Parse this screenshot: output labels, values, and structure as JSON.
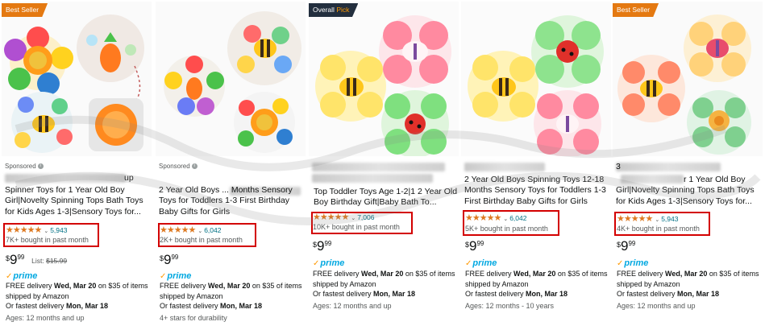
{
  "colors": {
    "badge_best_seller": "#e47911",
    "badge_overall": "#232f3e",
    "star": "#de7921",
    "link": "#007185",
    "prime": "#00a8e1",
    "highlight_box": "#d30000"
  },
  "products": [
    {
      "badge": "Best Seller",
      "sponsored": "Sponsored",
      "title": "Spinner Toys for 1 Year Old Boy Girl|Novelty Spinning Tops Bath Toys for Kids Ages 1-3|Sensory Toys for...",
      "title_partial": "up",
      "rating": 4.5,
      "rating_count": "5,943",
      "bought": "7K+ bought in past month",
      "price_whole": "9",
      "price_fraction": "99",
      "list_label": "List:",
      "list_price": "$15.99",
      "prime": "prime",
      "delivery_line1": "FREE delivery",
      "delivery_date": "Wed, Mar 20",
      "delivery_tail": "on $35 of items shipped by Amazon",
      "fastest_label": "Or fastest delivery",
      "fastest_date": "Mon, Mar 18",
      "extra": "Ages: 12 months and up",
      "image_icons": [
        "sunflower-spinner-icon",
        "carrot-spinner-icon",
        "bee-spinner-icon",
        "orange-cup-icon"
      ]
    },
    {
      "badge": "",
      "sponsored": "Sponsored",
      "title": "2 Year Old Boys ... Months Sensory Toys for Toddlers 1-3 First Birthday Baby Gifts for Girls",
      "rating": 4.5,
      "rating_count": "6,042",
      "bought": "2K+ bought in past month",
      "price_whole": "9",
      "price_fraction": "99",
      "prime": "prime",
      "delivery_line1": "FREE delivery",
      "delivery_date": "Wed, Mar 20",
      "delivery_tail": "on $35 of items shipped by Amazon",
      "fastest_label": "Or fastest delivery",
      "fastest_date": "Mon, Mar 18",
      "extra": "4+ stars for durability",
      "image_icons": [
        "carrot-spinner-icon",
        "bee-spinner-icon",
        "sunflower-spinner-icon"
      ]
    },
    {
      "badge_prefix": "Overall",
      "badge": "Pick",
      "sponsored": "",
      "title": "Top Toddler Toys Age 1-2|1 2 Year Old Boy Birthday Gift|Baby Bath To...",
      "rating": 4.5,
      "rating_count": "7,006",
      "bought": "10K+ bought in past month",
      "price_whole": "9",
      "price_fraction": "99",
      "prime": "prime",
      "delivery_line1": "FREE delivery",
      "delivery_date": "Wed, Mar 20",
      "delivery_tail": "on $35 of items shipped by Amazon",
      "fastest_label": "Or fastest delivery",
      "fastest_date": "Mon, Mar 18",
      "extra": "Ages: 12 months and up",
      "image_icons": [
        "bee-spinner-icon",
        "butterfly-spinner-icon",
        "ladybug-spinner-icon"
      ]
    },
    {
      "badge": "",
      "sponsored": "",
      "title": "2 Year Old Boys Spinning Toys 12-18 Months Sensory Toys for Toddlers 1-3 First Birthday Baby Gifts for Girls",
      "rating": 4.5,
      "rating_count": "6,042",
      "bought": "5K+ bought in past month",
      "price_whole": "9",
      "price_fraction": "99",
      "prime": "prime",
      "delivery_line1": "FREE delivery",
      "delivery_date": "Wed, Mar 20",
      "delivery_tail": "on $35 of items shipped by Amazon",
      "fastest_label": "Or fastest delivery",
      "fastest_date": "Mon, Mar 18",
      "extra": "Ages: 12 months - 10 years",
      "image_icons": [
        "ladybug-spinner-icon",
        "bee-spinner-icon",
        "butterfly-spinner-icon"
      ]
    },
    {
      "badge": "Best Seller",
      "sponsored": "",
      "title": "r 1 Year Old Boy Girl|Novelty Spinning Tops Bath Toys for Kids Ages 1-3|Sensory Toys for...",
      "title_partial": "3",
      "rating": 4.5,
      "rating_count": "5,943",
      "bought": "4K+ bought in past month",
      "price_whole": "9",
      "price_fraction": "99",
      "prime": "prime",
      "delivery_line1": "FREE delivery",
      "delivery_date": "Wed, Mar 20",
      "delivery_tail": "on $35 of items shipped by Amazon",
      "fastest_label": "Or fastest delivery",
      "fastest_date": "Mon, Mar 18",
      "extra": "Ages: 12 months and up",
      "image_icons": [
        "butterfly-spinner-icon",
        "bee-spinner-icon",
        "snail-spinner-icon"
      ]
    }
  ],
  "common": {
    "stars": "★★★★★",
    "star_half_note": "4.5 of 5",
    "chevron": "⌄",
    "dollar": "$"
  }
}
